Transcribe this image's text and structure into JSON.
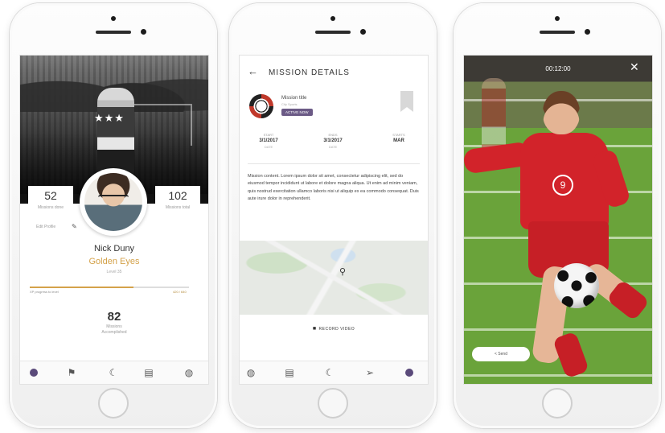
{
  "phone1": {
    "stars": "★★★",
    "stat_left": {
      "value": "52",
      "label": "Missions done"
    },
    "stat_right": {
      "value": "102",
      "label": "Missions total"
    },
    "edit_label": "Edit Profile",
    "name": "Nick Duny",
    "title": "Golden Eyes",
    "subtitle": "Level 35",
    "progress": {
      "fraction": 0.65,
      "left": "XP progress to level",
      "right": "420 / 640"
    },
    "score": {
      "value": "82",
      "label_line1": "Missions",
      "label_line2": "Accomplished"
    },
    "tabs": [
      "home-icon",
      "megaphone-icon",
      "moon-icon",
      "gallery-icon",
      "globe-icon"
    ]
  },
  "phone2": {
    "title": "MISSION DETAILS",
    "back_glyph": "←",
    "mission": {
      "name": "Mission title",
      "sub": "City Sports",
      "status": "ACTIVE NOW"
    },
    "dates": [
      {
        "label": "START",
        "value": "3/1/2017",
        "sub": "DATE"
      },
      {
        "label": "ENDS",
        "value": "3/1/2017",
        "sub": "DATE"
      },
      {
        "label": "STARTS",
        "value": "MAR",
        "sub": ""
      }
    ],
    "description": "Mission content. Lorem ipsum dolor sit amet, consectetur adipiscing elit, sed do eiusmod tempor incididunt ut labore et dolore magna aliqua. Ut enim ad minim veniam, quis nostrud exercitation ullamco laboris nisi ut aliquip ex ea commodo consequat. Duis aute irure dolor in reprehenderit.",
    "record_button": "RECORD VIDEO",
    "tabs": [
      "globe-icon",
      "gallery-icon",
      "moon-icon",
      "send-icon",
      "home-icon"
    ]
  },
  "phone3": {
    "timer": "00:12:00",
    "close_glyph": "✕",
    "send_button": "< Send",
    "jersey_number": "9"
  }
}
